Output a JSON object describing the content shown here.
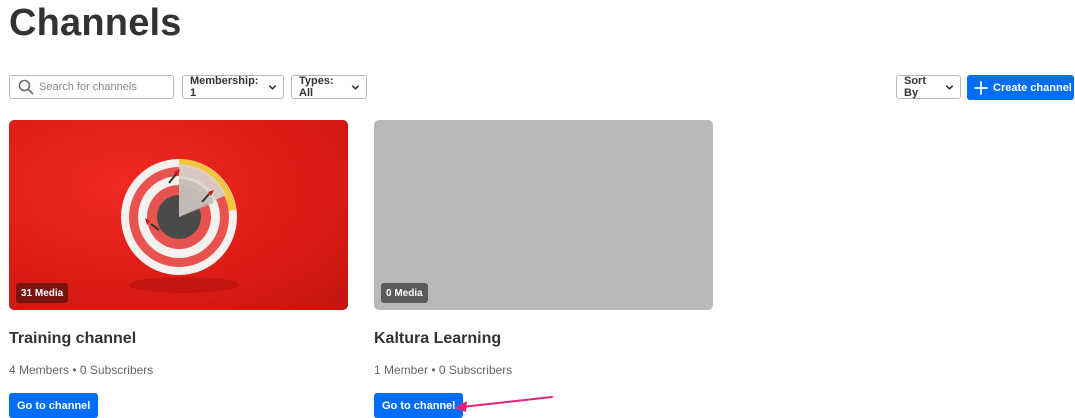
{
  "header": {
    "title": "Channels"
  },
  "toolbar": {
    "search_placeholder": "Search for channels",
    "search_value": "",
    "membership_label": "Membership: 1",
    "types_label": "Types: All",
    "sort_label": "Sort By",
    "create_label": "Create channel"
  },
  "channels": [
    {
      "title": "Training channel",
      "media_badge": "31 Media",
      "members": "4 Members",
      "subscribers": "0 Subscribers",
      "button_label": "Go to channel"
    },
    {
      "title": "Kaltura Learning",
      "media_badge": "0 Media",
      "members": "1 Member",
      "subscribers": "0 Subscribers",
      "button_label": "Go to channel"
    }
  ],
  "colors": {
    "primary": "#006efa",
    "thumb_red": "#db1b15",
    "thumb_gray": "#b9b9b9",
    "annotation_arrow": "#e5237a"
  },
  "icons": {
    "search": "search-icon",
    "chevron": "chevron-down-icon",
    "plus": "plus-icon"
  }
}
